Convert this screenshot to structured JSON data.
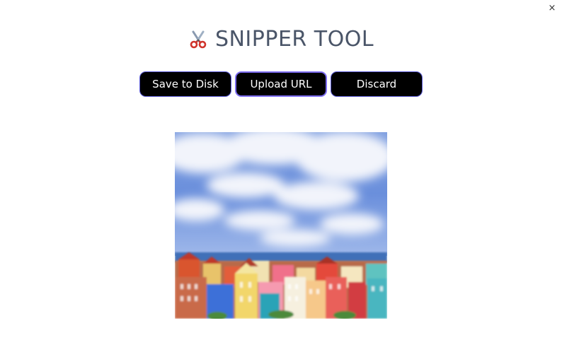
{
  "window": {
    "close_glyph": "×",
    "close_icon": "close-icon"
  },
  "header": {
    "icon": "scissors-icon",
    "title": "SNIPPER TOOL"
  },
  "toolbar": {
    "save_label": "Save to Disk",
    "upload_label": "Upload URL",
    "discard_label": "Discard"
  },
  "preview": {
    "image": "captured-screenshot-image"
  },
  "colors": {
    "title": "#4a5568",
    "button_bg": "#000000",
    "button_text": "#ffffff",
    "button_border": "#5b5bd6",
    "focus_border": "#7c6cf0"
  }
}
